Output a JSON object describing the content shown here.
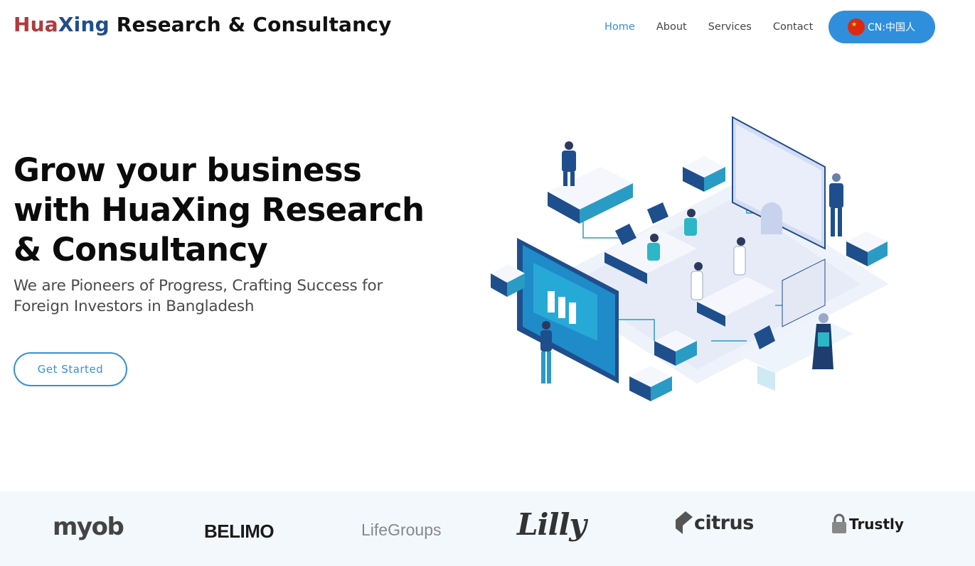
{
  "header": {
    "brand_part1": "Hua",
    "brand_part2": "Xing",
    "brand_part3": " Research & Consultancy",
    "nav": [
      {
        "label": "Home",
        "active": true
      },
      {
        "label": "About",
        "active": false
      },
      {
        "label": "Services",
        "active": false
      },
      {
        "label": "Contact",
        "active": false
      }
    ],
    "lang_button": "CN:中国人"
  },
  "hero": {
    "title": "Grow your business with HuaXing Research & Consultancy",
    "subtitle": "We are Pioneers of Progress, Crafting Success for Foreign Investors in Bangladesh",
    "cta": "Get Started"
  },
  "clients": [
    {
      "name": "myob"
    },
    {
      "name": "BELIMO"
    },
    {
      "name": "LifeGroups"
    },
    {
      "name": "Lilly"
    },
    {
      "name": "citrus"
    },
    {
      "name": "Trustly"
    }
  ],
  "colors": {
    "accent": "#3a8fd6",
    "brand_red": "#b13a3e",
    "brand_blue": "#1f4e8c",
    "client_strip_bg": "#f3f8fc"
  }
}
